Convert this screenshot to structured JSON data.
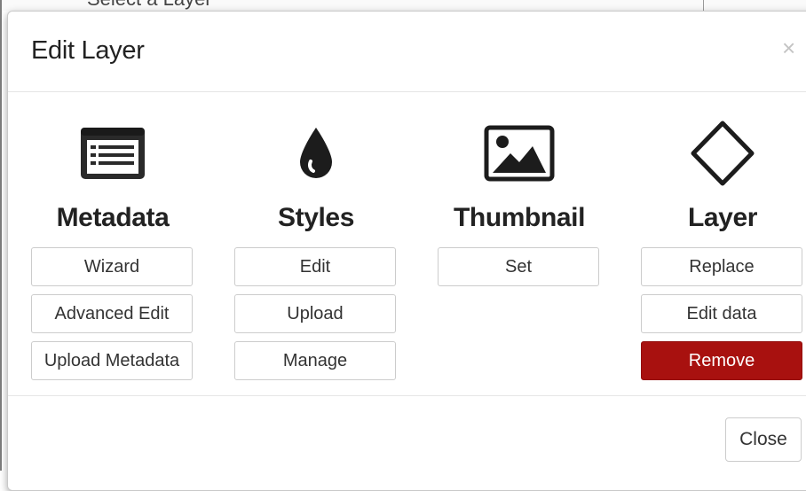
{
  "background": {
    "partial_text": "Select a Layer"
  },
  "dialog": {
    "title": "Edit Layer",
    "close_glyph": "×",
    "footer_close_label": "Close"
  },
  "sections": [
    {
      "title": "Metadata",
      "icon": "list-icon",
      "buttons": [
        {
          "label": "Wizard"
        },
        {
          "label": "Advanced Edit"
        },
        {
          "label": "Upload Metadata"
        }
      ]
    },
    {
      "title": "Styles",
      "icon": "droplet-icon",
      "buttons": [
        {
          "label": "Edit"
        },
        {
          "label": "Upload"
        },
        {
          "label": "Manage"
        }
      ]
    },
    {
      "title": "Thumbnail",
      "icon": "image-icon",
      "buttons": [
        {
          "label": "Set"
        }
      ]
    },
    {
      "title": "Layer",
      "icon": "diamond-icon",
      "buttons": [
        {
          "label": "Replace"
        },
        {
          "label": "Edit data"
        },
        {
          "label": "Remove",
          "style": "danger"
        }
      ]
    }
  ],
  "colors": {
    "danger": "#a8110f",
    "text": "#222222",
    "border": "#cccccc"
  }
}
